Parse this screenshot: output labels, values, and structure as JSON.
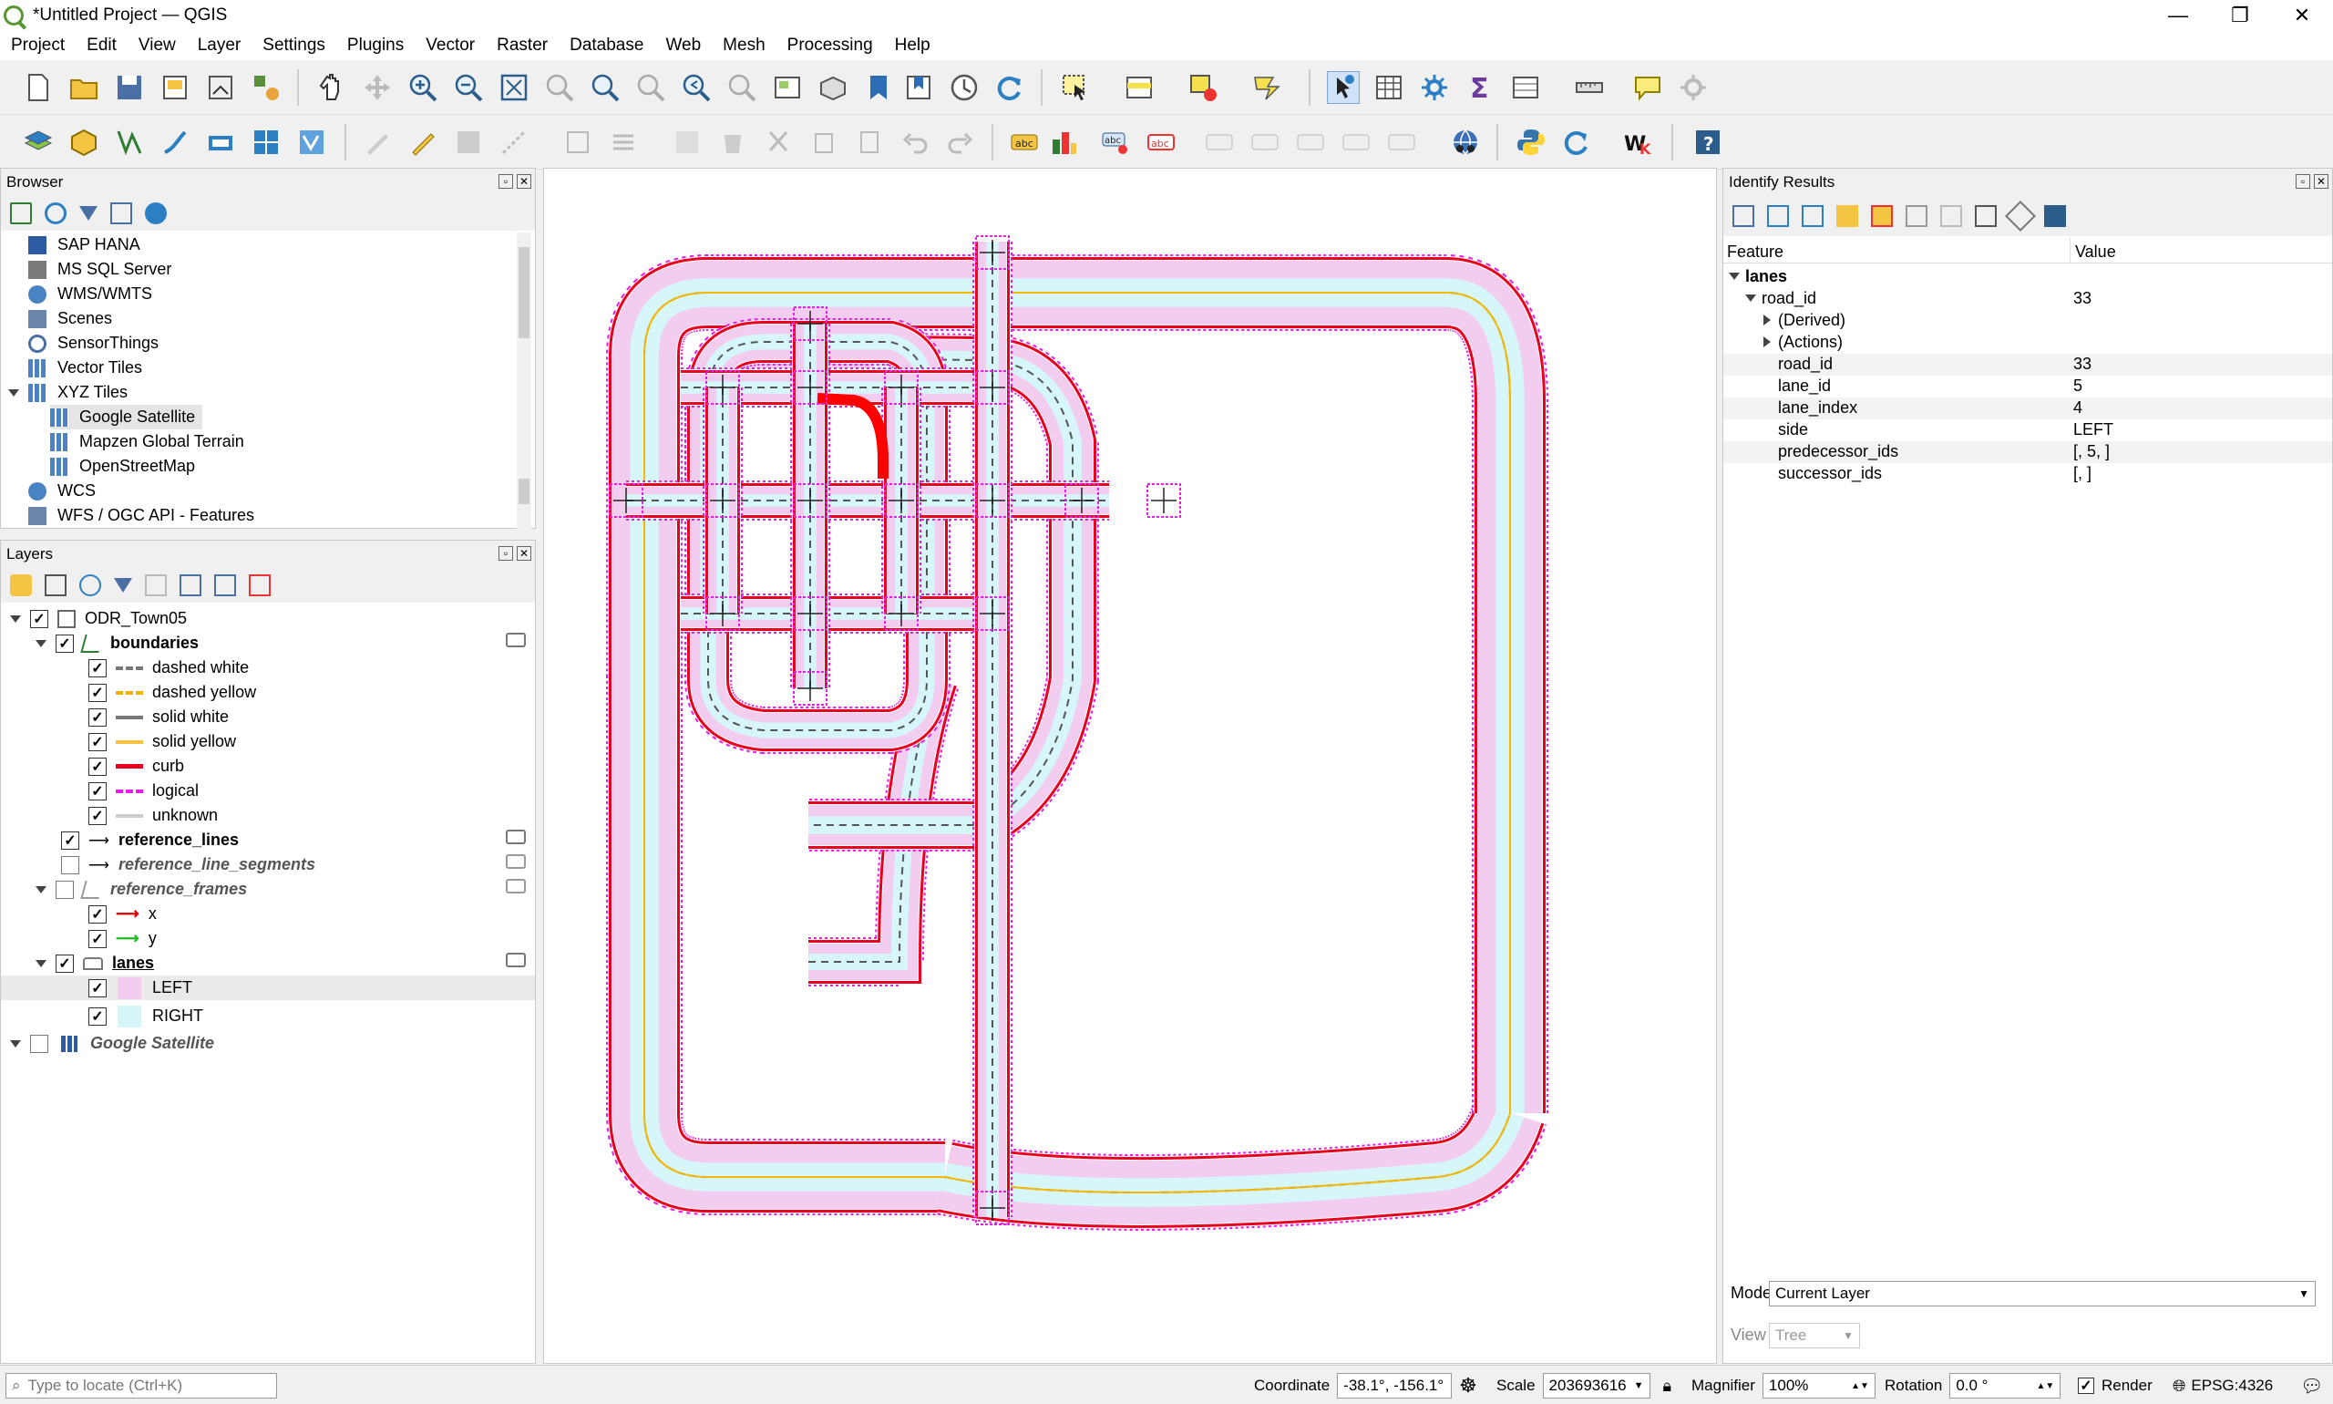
{
  "window": {
    "title": "*Untitled Project — QGIS",
    "controls": [
      "—",
      "❐",
      "✕"
    ]
  },
  "menu": [
    "Project",
    "Edit",
    "View",
    "Layer",
    "Settings",
    "Plugins",
    "Vector",
    "Raster",
    "Database",
    "Web",
    "Mesh",
    "Processing",
    "Help"
  ],
  "browser": {
    "title": "Browser",
    "items": [
      {
        "label": "SAP HANA",
        "icon": "sap-hana-icon"
      },
      {
        "label": "MS SQL Server",
        "icon": "mssql-icon"
      },
      {
        "label": "WMS/WMTS",
        "icon": "wms-icon"
      },
      {
        "label": "Scenes",
        "icon": "scenes-icon"
      },
      {
        "label": "SensorThings",
        "icon": "sensorthings-icon"
      },
      {
        "label": "Vector Tiles",
        "icon": "vector-tiles-icon"
      },
      {
        "label": "XYZ Tiles",
        "icon": "xyz-tiles-icon"
      },
      {
        "label": "Google Satellite",
        "icon": "xyz-tiles-icon"
      },
      {
        "label": "Mapzen Global Terrain",
        "icon": "xyz-tiles-icon"
      },
      {
        "label": "OpenStreetMap",
        "icon": "xyz-tiles-icon"
      },
      {
        "label": "WCS",
        "icon": "wcs-icon"
      },
      {
        "label": "WFS / OGC API - Features",
        "icon": "wfs-icon"
      }
    ]
  },
  "layers": {
    "title": "Layers",
    "group": "ODR_Town05",
    "boundaries": {
      "label": "boundaries",
      "items": [
        {
          "label": "dashed white",
          "color": "#777777",
          "style": "dashed"
        },
        {
          "label": "dashed yellow",
          "color": "#f0b000",
          "style": "dashed"
        },
        {
          "label": "solid white",
          "color": "#777777",
          "style": "solid"
        },
        {
          "label": "solid yellow",
          "color": "#f5c242",
          "style": "solid"
        },
        {
          "label": "curb",
          "color": "#e8001c",
          "style": "solid"
        },
        {
          "label": "logical",
          "color": "#e81ee8",
          "style": "dotted"
        },
        {
          "label": "unknown",
          "color": "#cccccc",
          "style": "solid"
        }
      ]
    },
    "reference_lines": "reference_lines",
    "reference_line_segments": "reference_line_segments",
    "reference_frames": {
      "label": "reference_frames",
      "items": [
        {
          "label": "x",
          "color": "#e00000"
        },
        {
          "label": "y",
          "color": "#22bb22"
        }
      ]
    },
    "lanes": {
      "label": "lanes",
      "items": [
        {
          "label": "LEFT",
          "color": "#f3cdf0"
        },
        {
          "label": "RIGHT",
          "color": "#d6f6fa"
        }
      ]
    },
    "satellite": "Google Satellite"
  },
  "identify": {
    "title": "Identify Results",
    "col_feature": "Feature",
    "col_value": "Value",
    "layer": "lanes",
    "feature_key": "road_id",
    "feature_val": "33",
    "derived": "(Derived)",
    "actions": "(Actions)",
    "attrs": [
      {
        "k": "road_id",
        "v": "33"
      },
      {
        "k": "lane_id",
        "v": "5"
      },
      {
        "k": "lane_index",
        "v": "4"
      },
      {
        "k": "side",
        "v": "LEFT"
      },
      {
        "k": "predecessor_ids",
        "v": "[, 5, ]"
      },
      {
        "k": "successor_ids",
        "v": "[, ]"
      }
    ],
    "mode_label": "Mode",
    "mode_value": "Current Layer",
    "view_label": "View",
    "view_value": "Tree"
  },
  "status": {
    "locate_placeholder": "Type to locate (Ctrl+K)",
    "coordinate_label": "Coordinate",
    "coordinate_value": "-38.1°, -156.1°",
    "scale_label": "Scale",
    "scale_value": "203693616",
    "magnifier_label": "Magnifier",
    "magnifier_value": "100%",
    "rotation_label": "Rotation",
    "rotation_value": "0.0 °",
    "render_label": "Render",
    "crs": "EPSG:4326"
  },
  "colors": {
    "curb": "#e8001c",
    "logical": "#e81ee8",
    "left_lane": "#f3cdf0",
    "right_lane": "#d6f6fa",
    "yellow": "#f5b800",
    "highlight": "#ff0000"
  }
}
